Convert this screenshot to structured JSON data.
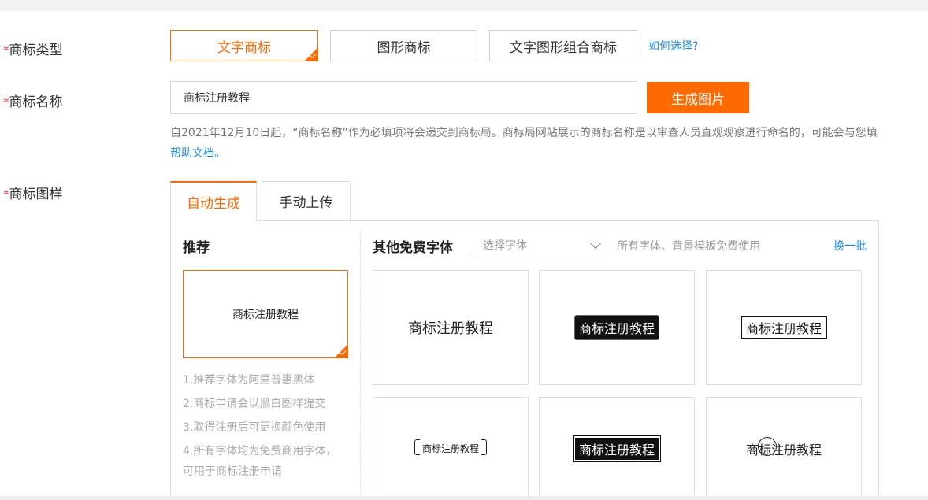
{
  "labels": {
    "required_mark": "*",
    "type": "商标类型",
    "name": "商标名称",
    "sample": "商标图样"
  },
  "type_options": [
    {
      "label": "文字商标",
      "selected": true
    },
    {
      "label": "图形商标",
      "selected": false
    },
    {
      "label": "文字图形组合商标",
      "selected": false
    }
  ],
  "how_to_choose": "如何选择?",
  "name_input": {
    "value": "商标注册教程"
  },
  "generate_button": "生成图片",
  "notice": "自2021年12月10日起，“商标名称”作为必填项将会递交到商标局。商标局网站展示的商标名称是以审查人员直观观察进行命名的，可能会与您填",
  "help_doc": "帮助文档。",
  "tabs": [
    {
      "label": "自动生成",
      "active": true
    },
    {
      "label": "手动上传",
      "active": false
    }
  ],
  "recommend": {
    "title": "推荐",
    "card_text": "商标注册教程",
    "tips": [
      "1.推荐字体为阿里普惠黑体",
      "2.商标申请会以黑白图样提交",
      "3.取得注册后可更换颜色使用",
      "4.所有字体均为免费商用字体，",
      "可用于商标注册申请"
    ]
  },
  "other_fonts": {
    "title": "其他免费字体",
    "select_placeholder": "选择字体",
    "free_note": "所有字体、背景模板免费使用",
    "refresh": "换一批",
    "cards": [
      {
        "text": "商标注册教程"
      },
      {
        "text": "商标注册教程"
      },
      {
        "text": "商标注册教程"
      },
      {
        "text": "商标注册教程"
      },
      {
        "text": "商标注册教程"
      },
      {
        "text": "商标注册教程"
      }
    ]
  },
  "colors": {
    "accent": "#ff6a00",
    "link": "#1e88e5",
    "required": "#e4393c"
  }
}
